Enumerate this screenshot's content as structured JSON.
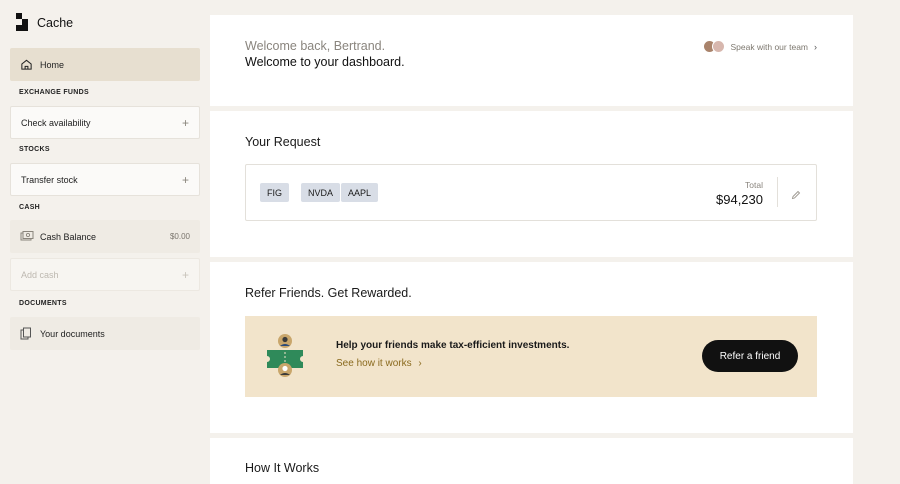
{
  "brand": {
    "name": "Cache",
    "icon": "cache-logo-icon"
  },
  "sidebar": {
    "home": {
      "label": "Home",
      "icon": "home-icon"
    },
    "sections": {
      "exchange": "EXCHANGE FUNDS",
      "stocks": "STOCKS",
      "cash": "CASH",
      "documents": "DOCUMENTS"
    },
    "check_availability": "Check availability",
    "transfer_stock": "Transfer stock",
    "cash_balance": {
      "label": "Cash Balance",
      "amount": "$0.00",
      "icon": "cash-icon"
    },
    "add_cash": "Add cash",
    "your_documents": {
      "label": "Your documents",
      "icon": "documents-icon"
    }
  },
  "welcome": {
    "line1": "Welcome back, Bertrand.",
    "line2": "Welcome to your dashboard.",
    "team_link": "Speak with our team"
  },
  "request": {
    "title": "Your Request",
    "tickers": [
      "FIG",
      "NVDA",
      "AAPL"
    ],
    "total_label": "Total",
    "total_value": "$94,230"
  },
  "refer": {
    "title": "Refer Friends. Get Rewarded.",
    "headline": "Help your friends make tax-efficient investments.",
    "link": "See how it works",
    "button": "Refer a friend"
  },
  "how": {
    "title": "How It Works"
  },
  "colors": {
    "background": "#f4f1ec",
    "home_active": "#e7dfd0",
    "chip": "#d8dde6",
    "refer_bg": "#f2e4cb",
    "link_gold": "#8a6a1e",
    "ticket_green": "#2f8a5a"
  }
}
